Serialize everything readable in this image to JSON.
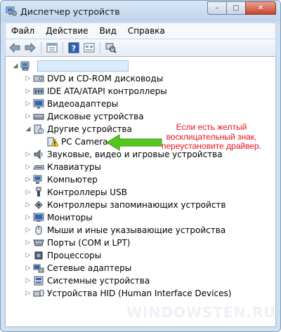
{
  "window": {
    "title": "Диспетчер устройств"
  },
  "title_buttons": {
    "minimize": "–",
    "maximize": "□",
    "close": "✕"
  },
  "menu": {
    "items": [
      "Файл",
      "Действие",
      "Вид",
      "Справка"
    ]
  },
  "toolbar": {
    "icons": [
      "back-icon",
      "forward-icon",
      "properties-icon",
      "help-icon",
      "details-icon",
      "scan-icon"
    ]
  },
  "tree": {
    "root_label": "",
    "items": [
      {
        "label": "DVD и CD-ROM дисководы",
        "icon": "dvd-drive-icon",
        "expanded": false
      },
      {
        "label": "IDE ATA/ATAPI контроллеры",
        "icon": "ide-controller-icon",
        "expanded": false
      },
      {
        "label": "Видеоадаптеры",
        "icon": "display-adapter-icon",
        "expanded": false
      },
      {
        "label": "Дисковые устройства",
        "icon": "disk-drive-icon",
        "expanded": false
      },
      {
        "label": "Другие устройства",
        "icon": "unknown-device-icon",
        "expanded": true
      },
      {
        "label": "PC Camera",
        "icon": "warning-device-icon",
        "child": true
      },
      {
        "label": "Звуковые, видео и игровые устройства",
        "icon": "sound-icon",
        "expanded": false
      },
      {
        "label": "Клавиатуры",
        "icon": "keyboard-icon",
        "expanded": false
      },
      {
        "label": "Компьютер",
        "icon": "computer-icon",
        "expanded": false
      },
      {
        "label": "Контроллеры USB",
        "icon": "usb-icon",
        "expanded": false
      },
      {
        "label": "Контроллеры запоминающих устройств",
        "icon": "storage-controller-icon",
        "expanded": false
      },
      {
        "label": "Мониторы",
        "icon": "monitor-icon",
        "expanded": false
      },
      {
        "label": "Мыши и иные указывающие устройства",
        "icon": "mouse-icon",
        "expanded": false
      },
      {
        "label": "Порты (COM и LPT)",
        "icon": "port-icon",
        "expanded": false
      },
      {
        "label": "Процессоры",
        "icon": "processor-icon",
        "expanded": false
      },
      {
        "label": "Сетевые адаптеры",
        "icon": "network-adapter-icon",
        "expanded": false
      },
      {
        "label": "Системные устройства",
        "icon": "system-device-icon",
        "expanded": false
      },
      {
        "label": "Устройства HID (Human Interface Devices)",
        "icon": "hid-icon",
        "expanded": false
      }
    ]
  },
  "annotation": {
    "line1": "Если есть желтый",
    "line2": "восклицательный знак,",
    "line3": "переустановите драйвер."
  },
  "watermark": "WINDOWSTEN.RU",
  "colors": {
    "annotation_text": "#e8121f",
    "arrow": "#55c81e",
    "titlebar": "#bed4ec"
  }
}
